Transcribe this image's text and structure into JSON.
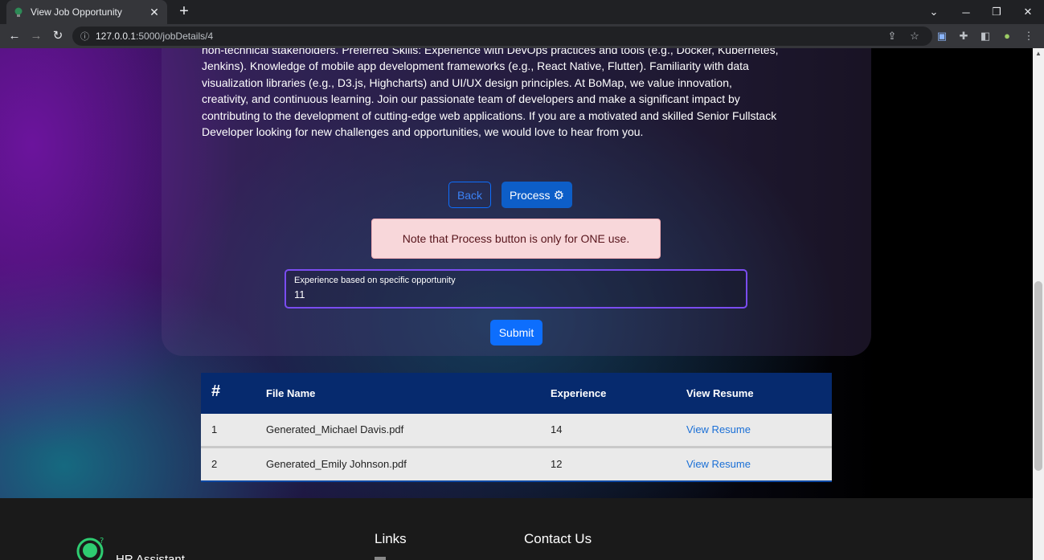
{
  "browser": {
    "tab_title": "View Job Opportunity",
    "url_host": "127.0.0.1",
    "url_path": ":5000/jobDetails/4"
  },
  "job": {
    "description": "non-technical stakeholders. Preferred Skills: Experience with DevOps practices and tools (e.g., Docker, Kubernetes, Jenkins). Knowledge of mobile app development frameworks (e.g., React Native, Flutter). Familiarity with data visualization libraries (e.g., D3.js, Highcharts) and UI/UX design principles. At BoMap, we value innovation, creativity, and continuous learning. Join our passionate team of developers and make a significant impact by contributing to the development of cutting-edge web applications. If you are a motivated and skilled Senior Fullstack Developer looking for new challenges and opportunities, we would love to hear from you."
  },
  "actions": {
    "back_label": "Back",
    "process_label": "Process"
  },
  "alert": {
    "text": "Note that Process button is only for ONE use."
  },
  "experience_field": {
    "label": "Experience based on specific opportunity",
    "value": "11"
  },
  "submit_label": "Submit",
  "table": {
    "headers": [
      "#",
      "File Name",
      "Experience",
      "View Resume"
    ],
    "rows": [
      {
        "index": "1",
        "file": "Generated_Michael Davis.pdf",
        "experience": "14",
        "link": "View Resume"
      },
      {
        "index": "2",
        "file": "Generated_Emily Johnson.pdf",
        "experience": "12",
        "link": "View Resume"
      }
    ]
  },
  "footer": {
    "brand": "HR Assistant",
    "links_heading": "Links",
    "contact_heading": "Contact Us"
  },
  "colors": {
    "primary": "#0d6efd",
    "table_header": "#062a6e",
    "alert_bg": "#f8d7da"
  }
}
